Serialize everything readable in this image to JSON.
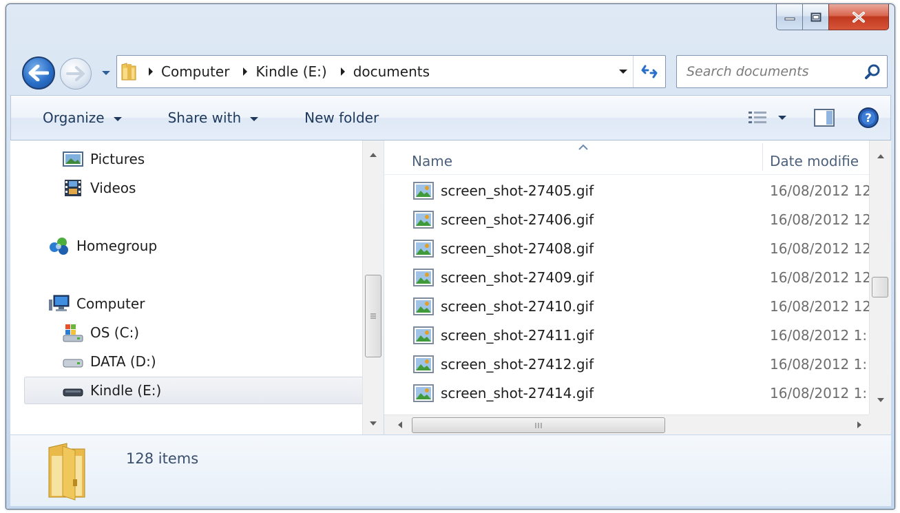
{
  "window": {
    "caption_buttons": [
      "minimize",
      "maximize",
      "close"
    ]
  },
  "address_bar": {
    "breadcrumbs": [
      "Computer",
      "Kindle (E:)",
      "documents"
    ]
  },
  "search": {
    "placeholder": "Search documents"
  },
  "command_bar": {
    "organize_label": "Organize",
    "share_label": "Share with",
    "new_folder_label": "New folder"
  },
  "nav_pane": {
    "items": [
      {
        "label": "Pictures",
        "icon": "pictures-icon"
      },
      {
        "label": "Videos",
        "icon": "videos-icon"
      },
      {
        "label": "Homegroup",
        "icon": "homegroup-icon"
      },
      {
        "label": "Computer",
        "icon": "computer-icon"
      },
      {
        "label": "OS (C:)",
        "icon": "os-drive-icon"
      },
      {
        "label": "DATA (D:)",
        "icon": "drive-icon"
      },
      {
        "label": "Kindle (E:)",
        "icon": "removable-drive-icon",
        "selected": true
      }
    ]
  },
  "file_list": {
    "columns": [
      "Name",
      "Date modifie"
    ],
    "files": [
      {
        "name": "screen_shot-27405.gif",
        "date": "16/08/2012 12"
      },
      {
        "name": "screen_shot-27406.gif",
        "date": "16/08/2012 12"
      },
      {
        "name": "screen_shot-27408.gif",
        "date": "16/08/2012 12"
      },
      {
        "name": "screen_shot-27409.gif",
        "date": "16/08/2012 12"
      },
      {
        "name": "screen_shot-27410.gif",
        "date": "16/08/2012 12"
      },
      {
        "name": "screen_shot-27411.gif",
        "date": "16/08/2012 1:"
      },
      {
        "name": "screen_shot-27412.gif",
        "date": "16/08/2012 1:"
      },
      {
        "name": "screen_shot-27414.gif",
        "date": "16/08/2012 1:"
      }
    ]
  },
  "details_pane": {
    "item_count": "128 items"
  },
  "colors": {
    "chrome": "#cfdff0",
    "accent_blue": "#2a6fc7",
    "close_red": "#c0391f",
    "command_text": "#1e395b"
  }
}
